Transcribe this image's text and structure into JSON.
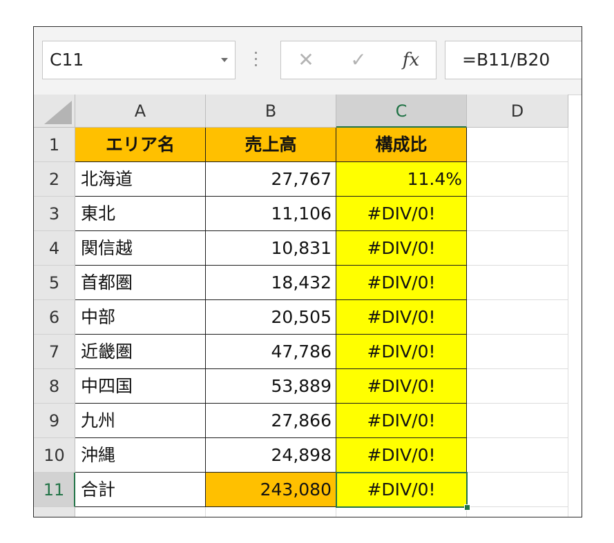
{
  "formula_bar": {
    "name_box": "C11",
    "cancel_icon": "✕",
    "enter_icon": "✓",
    "fx_label": "fx",
    "formula": "=B11/B20"
  },
  "columns": [
    "A",
    "B",
    "C",
    "D"
  ],
  "selected_column": "C",
  "selected_row": "11",
  "colors": {
    "header_fill": "#ffc000",
    "ratio_fill": "#ffff00",
    "selection": "#217346"
  },
  "rows": [
    {
      "num": "1",
      "a": "エリア名",
      "b": "売上高",
      "c": "構成比"
    },
    {
      "num": "2",
      "a": "北海道",
      "b": "27,767",
      "c": "11.4%"
    },
    {
      "num": "3",
      "a": "東北",
      "b": "11,106",
      "c": "#DIV/0!"
    },
    {
      "num": "4",
      "a": "関信越",
      "b": "10,831",
      "c": "#DIV/0!"
    },
    {
      "num": "5",
      "a": "首都圏",
      "b": "18,432",
      "c": "#DIV/0!"
    },
    {
      "num": "6",
      "a": "中部",
      "b": "20,505",
      "c": "#DIV/0!"
    },
    {
      "num": "7",
      "a": "近畿圏",
      "b": "47,786",
      "c": "#DIV/0!"
    },
    {
      "num": "8",
      "a": "中四国",
      "b": "53,889",
      "c": "#DIV/0!"
    },
    {
      "num": "9",
      "a": "九州",
      "b": "27,866",
      "c": "#DIV/0!"
    },
    {
      "num": "10",
      "a": "沖縄",
      "b": "24,898",
      "c": "#DIV/0!"
    },
    {
      "num": "11",
      "a": "合計",
      "b": "243,080",
      "c": "#DIV/0!"
    }
  ]
}
